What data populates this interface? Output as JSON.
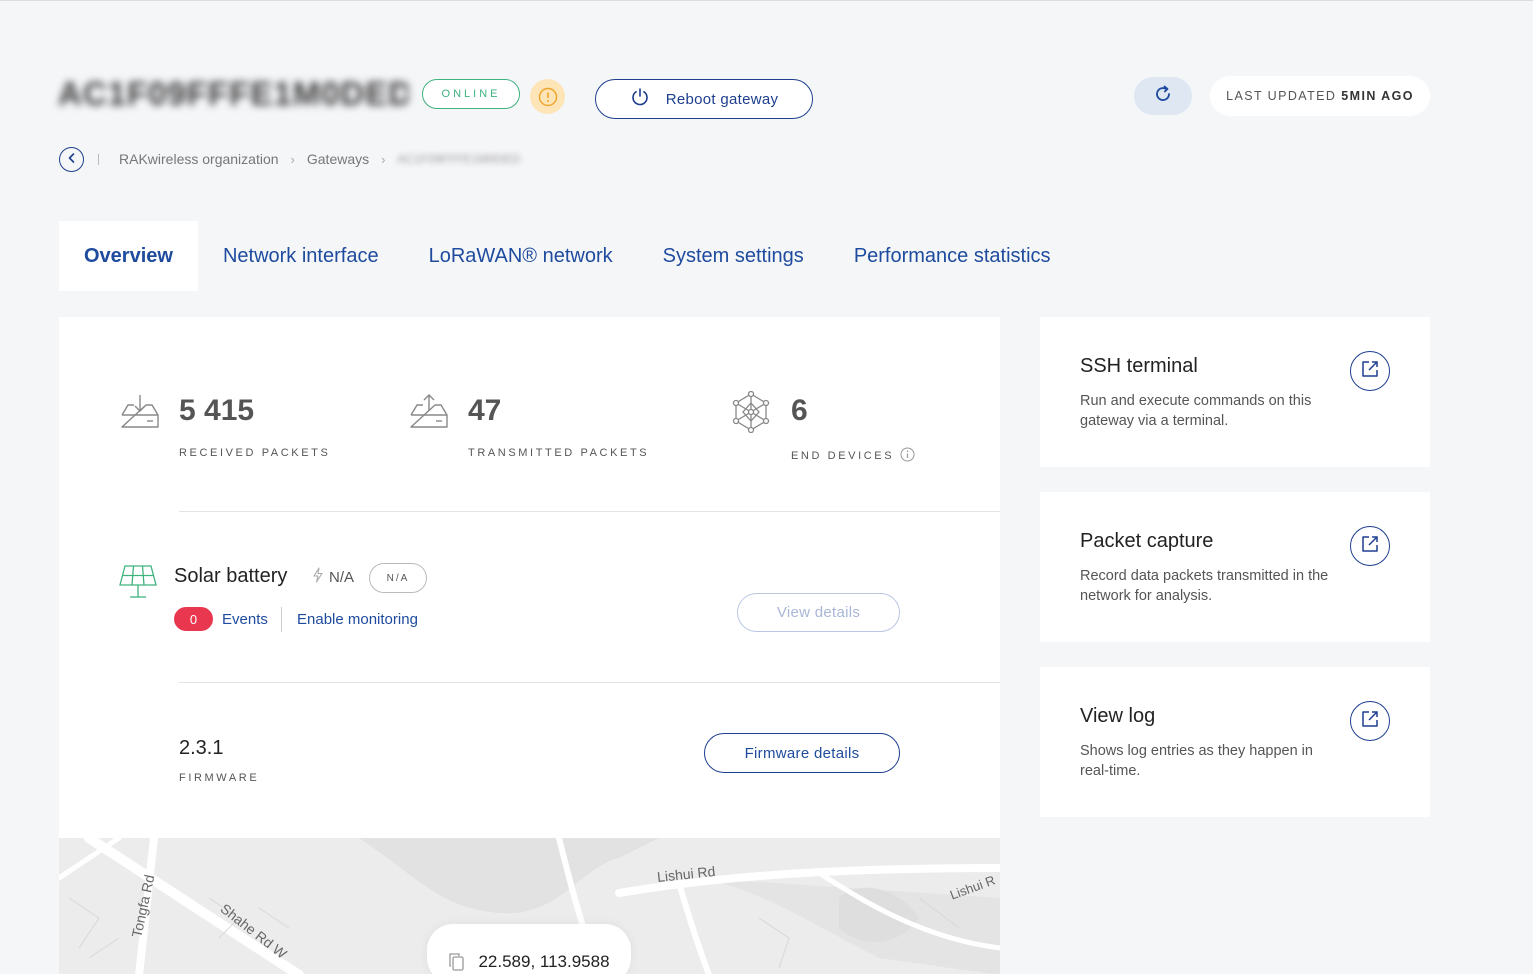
{
  "header": {
    "gateway_id": "AC1F09FFFE1M0DED",
    "status": "ONLINE",
    "reboot_label": "Reboot gateway",
    "last_updated_label": "LAST UPDATED",
    "last_updated_value": "5MIN AGO"
  },
  "breadcrumb": {
    "items": [
      "RAKwireless organization",
      "Gateways",
      "AC1F09FFFE1M0DED"
    ]
  },
  "tabs": [
    {
      "label": "Overview",
      "active": true
    },
    {
      "label": "Network interface",
      "active": false
    },
    {
      "label": "LoRaWAN® network",
      "active": false
    },
    {
      "label": "System settings",
      "active": false
    },
    {
      "label": "Performance statistics",
      "active": false
    }
  ],
  "stats": {
    "received": {
      "value": "5 415",
      "label": "RECEIVED PACKETS"
    },
    "transmitted": {
      "value": "47",
      "label": "TRANSMITTED PACKETS"
    },
    "end_devices": {
      "value": "6",
      "label": "END DEVICES"
    }
  },
  "solar": {
    "title": "Solar battery",
    "power_value": "N/A",
    "status_pill": "N/A",
    "events_count": "0",
    "events_label": "Events",
    "enable_label": "Enable monitoring",
    "view_details_label": "View details"
  },
  "firmware": {
    "version": "2.3.1",
    "label": "FIRMWARE",
    "button_label": "Firmware details"
  },
  "map": {
    "coordinates": "22.589, 113.9588",
    "roads": [
      "Lishui Rd",
      "Lishui R",
      "Tongfa Rd",
      "Shahe Rd W"
    ]
  },
  "side_cards": [
    {
      "title": "SSH terminal",
      "desc": "Run and execute commands on this gateway via a terminal."
    },
    {
      "title": "Packet capture",
      "desc": "Record data packets transmitted in the network for analysis."
    },
    {
      "title": "View log",
      "desc": "Shows log entries as they happen in real-time."
    }
  ],
  "colors": {
    "primary": "#1e3f8f",
    "online": "#3fb27f",
    "danger": "#e8374f",
    "warning_bg": "#fde5b8",
    "solar_icon": "#3fb27f"
  }
}
